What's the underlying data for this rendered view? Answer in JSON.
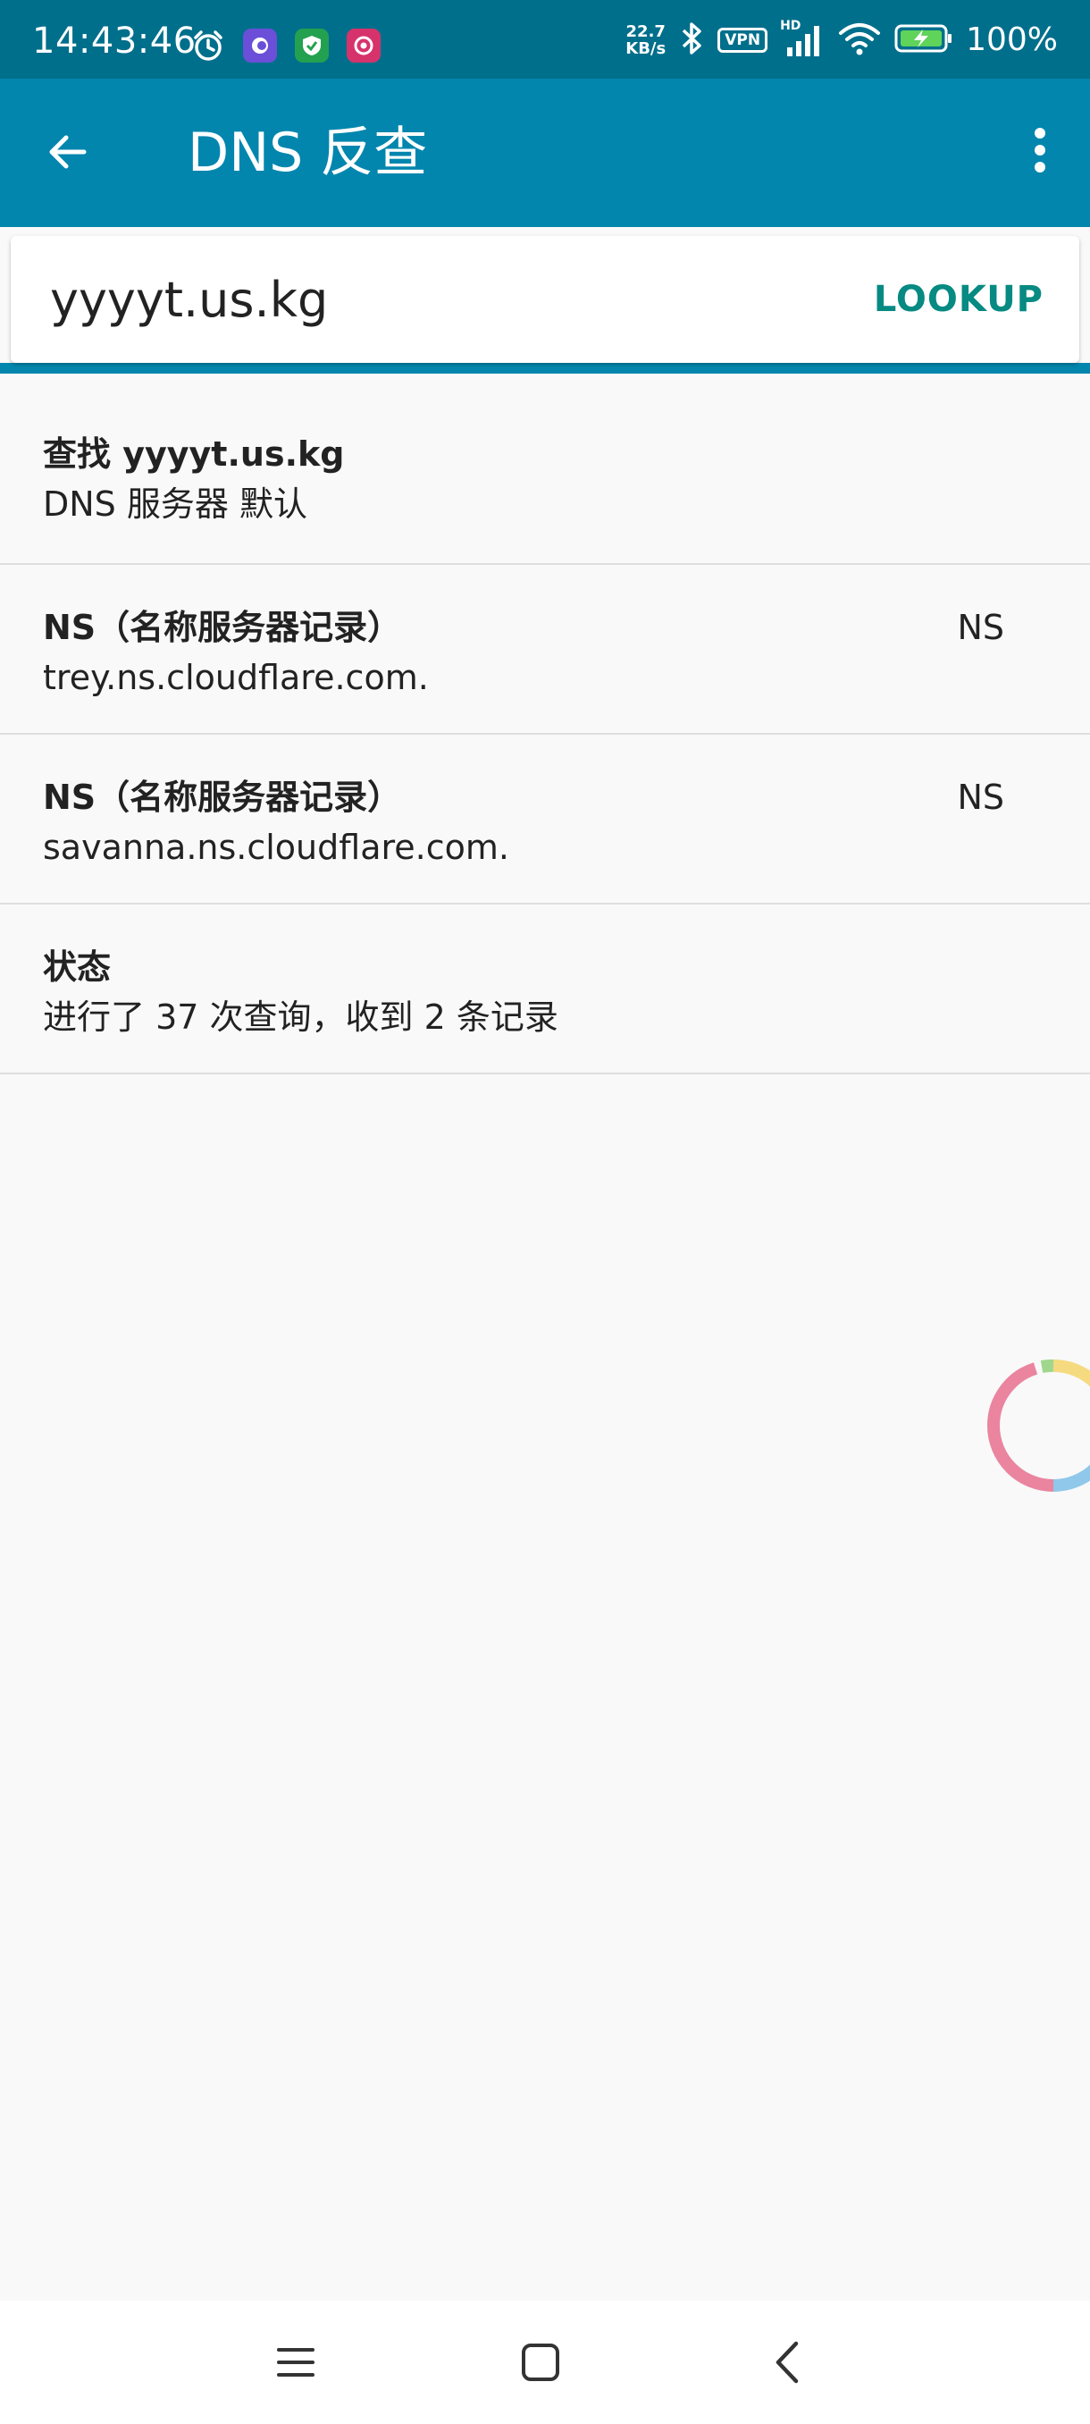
{
  "status_bar": {
    "time": "14:43:46",
    "net_speed_value": "22.7",
    "net_speed_unit": "KB/s",
    "vpn_label": "VPN",
    "hd_label": "HD",
    "battery_percent": "100%"
  },
  "app_bar": {
    "title": "DNS 反查",
    "back_icon": "arrow-left-icon",
    "menu_icon": "more-vert-icon"
  },
  "search": {
    "value": "yyyyt.us.kg",
    "lookup_label": "LOOKUP"
  },
  "results": {
    "query": {
      "title": "查找 yyyyt.us.kg",
      "subtitle": "DNS 服务器 默认"
    },
    "records": [
      {
        "title": "NS（名称服务器记录）",
        "value": "trey.ns.cloudflare.com.",
        "type": "NS"
      },
      {
        "title": "NS（名称服务器记录）",
        "value": "savanna.ns.cloudflare.com.",
        "type": "NS"
      }
    ],
    "status": {
      "title": "状态",
      "subtitle": "进行了 37 次查询，收到 2 条记录"
    }
  },
  "colors": {
    "status_bar": "#006f8c",
    "app_bar": "#0286ae",
    "accent": "#068a82",
    "background": "#f9f9f9"
  },
  "nav_bar": {
    "items": [
      "menu-icon",
      "home-icon",
      "back-icon"
    ]
  }
}
